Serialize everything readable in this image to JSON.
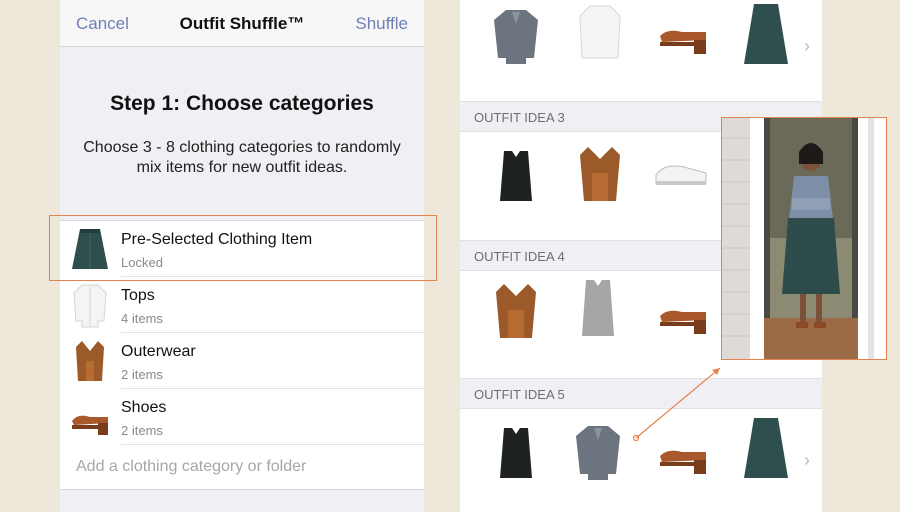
{
  "nav": {
    "cancel_label": "Cancel",
    "title": "Outfit Shuffle™",
    "shuffle_label": "Shuffle"
  },
  "step": {
    "title": "Step 1: Choose categories",
    "description": "Choose 3 - 8 clothing categories to randomly mix items for new outfit ideas."
  },
  "categories": [
    {
      "name": "Pre-Selected Clothing Item",
      "sub": "Locked",
      "icon": "teal-skirt-icon"
    },
    {
      "name": "Tops",
      "sub": "4 items",
      "icon": "white-blouse-icon"
    },
    {
      "name": "Outerwear",
      "sub": "2 items",
      "icon": "brown-vest-icon"
    },
    {
      "name": "Shoes",
      "sub": "2 items",
      "icon": "clog-sandal-icon"
    }
  ],
  "add_category_placeholder": "Add a clothing category or folder",
  "outfits": [
    {
      "label": "OUTFIT IDEA 3",
      "items": [
        "black-tank-icon",
        "brown-vest-icon",
        "white-sneaker-icon"
      ]
    },
    {
      "label": "OUTFIT IDEA 4",
      "items": [
        "brown-vest-icon",
        "grey-tank-icon",
        "clog-sandal-icon"
      ]
    },
    {
      "label": "OUTFIT IDEA 5",
      "items": [
        "black-tank-icon",
        "denim-jacket-icon",
        "clog-sandal-icon",
        "teal-skirt-icon"
      ]
    }
  ],
  "colors": {
    "accent": "#6f7fb5",
    "highlight": "#e38450",
    "background": "#ede8da"
  }
}
